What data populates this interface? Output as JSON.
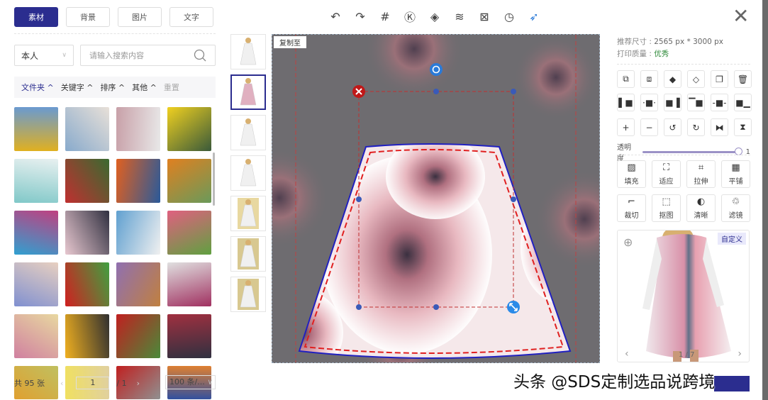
{
  "left": {
    "tabs": [
      "素材",
      "背景",
      "图片",
      "文字"
    ],
    "owner_select": "本人",
    "search_placeholder": "请输入搜索内容",
    "filters": [
      "文件夹",
      "关键字",
      "排序",
      "其他"
    ],
    "reset": "重置",
    "total": "共 95 张",
    "page": "1",
    "page_total": "/ 1",
    "page_size": "100 条/...",
    "thumb_colors": [
      [
        "#e0b020",
        "#6a9ad0"
      ],
      [
        "#88aacc",
        "#e8e0d8"
      ],
      [
        "#c8a0a8",
        "#e8e8e8"
      ],
      [
        "#f0d020",
        "#3a5a3a"
      ],
      [
        "#80c8c8",
        "#e8f0f0"
      ],
      [
        "#c03030",
        "#3a6a30"
      ],
      [
        "#e06020",
        "#2a5a9a"
      ],
      [
        "#e08020",
        "#6a9a5a"
      ],
      [
        "#30a0d0",
        "#c04080"
      ],
      [
        "#e8c8d0",
        "#303040"
      ],
      [
        "#60a0d0",
        "#f0f0f0"
      ],
      [
        "#e06080",
        "#60a040"
      ],
      [
        "#8090d0",
        "#e8d0c0"
      ],
      [
        "#d02020",
        "#40a040"
      ],
      [
        "#9070b0",
        "#c08040"
      ],
      [
        "#e0e0e0",
        "#a03060"
      ],
      [
        "#d080a0",
        "#e8d8a0"
      ],
      [
        "#f0b020",
        "#303030"
      ],
      [
        "#c02020",
        "#4a8a3a"
      ],
      [
        "#a03040",
        "#303040"
      ],
      [
        "#e0a030",
        "#c0c060"
      ],
      [
        "#f0e060",
        "#e0d0a0"
      ],
      [
        "#c02020",
        "#909090"
      ],
      [
        "#3050a0",
        "#e08030"
      ]
    ]
  },
  "toolbar": {
    "icons": [
      "undo-icon",
      "redo-icon",
      "grid-icon",
      "k-icon",
      "fill-bucket-icon",
      "layers-icon",
      "delete-box-icon",
      "history-icon",
      "rocket-icon"
    ],
    "glyphs": [
      "↶",
      "↷",
      "#",
      "Ⓚ",
      "◈",
      "≋",
      "⊠",
      "◷",
      "➶"
    ]
  },
  "canvas": {
    "copy_label": "复制至"
  },
  "right": {
    "size_label": "推荐尺寸 : ",
    "size_value": "2565 px * 3000 px",
    "quality_label": "打印质量 : ",
    "quality_value": "优秀",
    "row1": [
      "⧉",
      "⧈",
      "◆",
      "◇",
      "❐",
      "🗑"
    ],
    "row2": [
      "▌■",
      "·■·",
      "■▐",
      "▔■",
      "-■-",
      "■▁"
    ],
    "row3": [
      "+",
      "−",
      "↺",
      "↻",
      "⧓",
      "⧗"
    ],
    "opacity_label": "透明度",
    "opacity_value": "1",
    "opacity": 1,
    "tools": [
      {
        "icon": "▨",
        "label": "填充"
      },
      {
        "icon": "⛶",
        "label": "适应"
      },
      {
        "icon": "⌗",
        "label": "拉伸"
      },
      {
        "icon": "▦",
        "label": "平铺"
      },
      {
        "icon": "⌐",
        "label": "裁切"
      },
      {
        "icon": "⬚",
        "label": "抠图"
      },
      {
        "icon": "◐",
        "label": "清晰"
      },
      {
        "icon": "♲",
        "label": "滤镜"
      }
    ],
    "custom_label": "自定义",
    "preview_count": "1 / 7"
  },
  "watermark": "头条 @SDS定制选品说跨境",
  "colors": {
    "accent": "#2b2d8f",
    "good": "#2f8a3a"
  }
}
